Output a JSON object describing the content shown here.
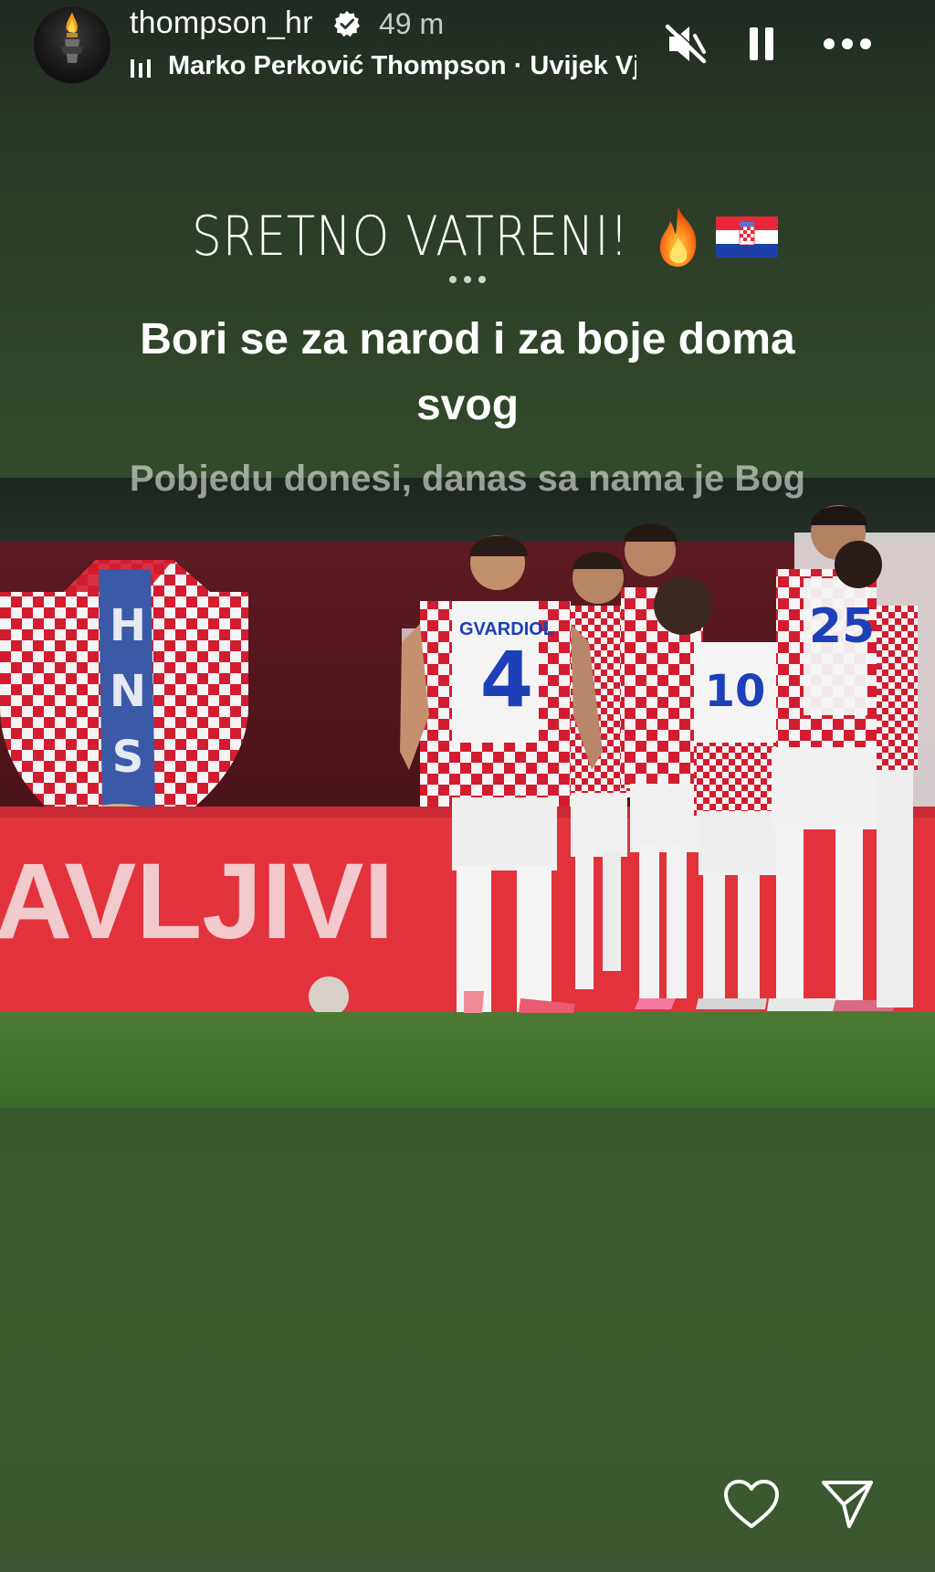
{
  "story": {
    "username": "thompson_hr",
    "time_ago": "49 m",
    "music": "Marko Perković Thompson · Uvijek Vjeran",
    "caption_title": "SRETNO VATRENI!",
    "emoji": [
      "fire",
      "croatia-flag"
    ],
    "lyric_active": "Bori se za narod i za boje doma svog",
    "lyric_next": "Pobjedu donesi, danas sa nama je Bog"
  },
  "photo": {
    "hns_crest_letters": "HNS",
    "banner_text": "AVLJIVI",
    "player_name": "GVARDIOL",
    "player_number": "4",
    "number_2": "10",
    "number_3": "25"
  },
  "controls": {
    "mute_icon": "speaker-muted-icon",
    "pause_icon": "pause-icon",
    "more_icon": "more-icon",
    "like_icon": "heart-icon",
    "share_icon": "send-icon"
  },
  "colors": {
    "crest_red": "#d31c2f",
    "crest_white": "#f3f3f3",
    "kit_blue": "#1d3fb8",
    "pitch_green": "#3f6b2b"
  }
}
